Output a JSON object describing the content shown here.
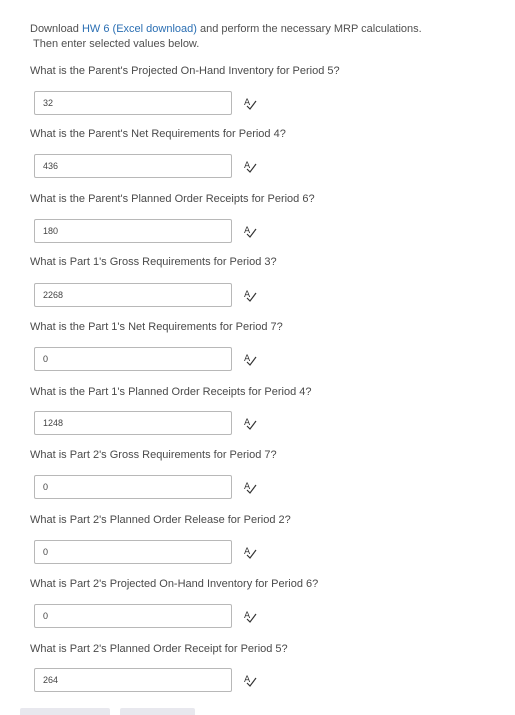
{
  "intro": {
    "prefix": "Download ",
    "link1": "HW 6",
    "link2": "(Excel download)",
    "suffix": " and perform the necessary MRP calculations.",
    "line2": "Then enter selected values below."
  },
  "questions": [
    {
      "text": "What is the Parent's Projected On-Hand Inventory for Period 5?",
      "value": "32"
    },
    {
      "text": "What is the Parent's Net Requirements for Period 4?",
      "value": "436"
    },
    {
      "text": "What is the Parent's Planned Order Receipts for Period 6?",
      "value": "180"
    },
    {
      "text": "What is Part 1's Gross Requirements for Period 3?",
      "value": "2268"
    },
    {
      "text": "What is the Part 1's Net Requirements for Period 7?",
      "value": "0"
    },
    {
      "text": "What is the Part 1's Planned Order Receipts for Period 4?",
      "value": "1248"
    },
    {
      "text": "What is Part 2's Gross Requirements for Period 7?",
      "value": "0"
    },
    {
      "text": "What is Part 2's Planned Order Release for Period 2?",
      "value": "0"
    },
    {
      "text": "What is Part 2's Projected On-Hand Inventory for Period 6?",
      "value": "0"
    },
    {
      "text": "What is Part 2's Planned Order Receipt for Period 5?",
      "value": "264"
    }
  ],
  "icons": {
    "spellcheck": "spellcheck-icon"
  }
}
